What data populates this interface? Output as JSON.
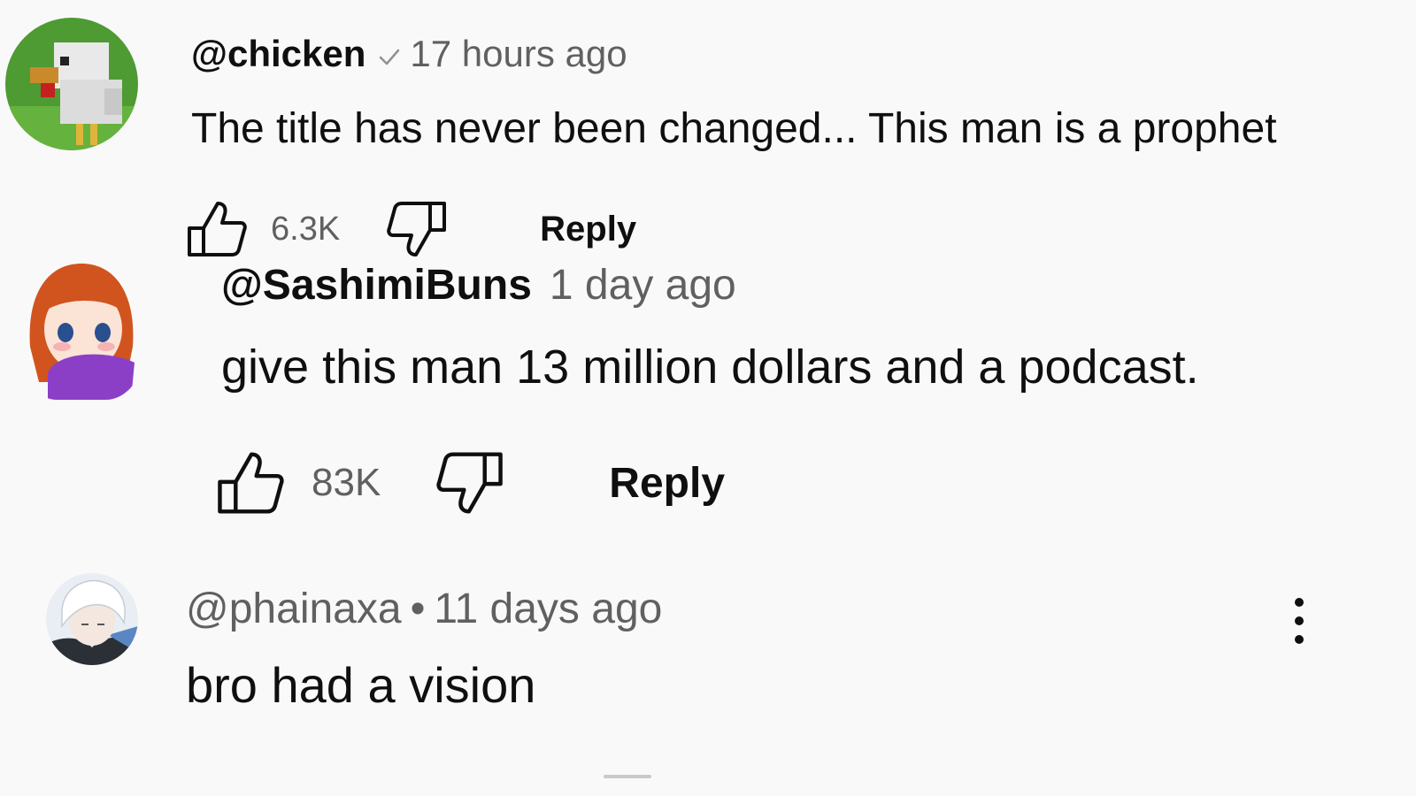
{
  "comments": [
    {
      "handle": "@chicken",
      "time": "17 hours ago",
      "text": "The title has never been changed... This man is a prophet",
      "likes": "6.3K",
      "reply_label": "Reply",
      "avatar_icon": "chicken-avatar-icon",
      "verified_icon": "check-icon"
    },
    {
      "handle": "@SashimiBuns",
      "time": "1 day ago",
      "text": "give this man 13 million dollars and a podcast.",
      "likes": "83K",
      "reply_label": "Reply",
      "avatar_icon": "anime-girl-avatar-icon"
    },
    {
      "handle": "@phainaxa",
      "separator": "•",
      "time": "11 days ago",
      "text": "bro had a vision",
      "avatar_icon": "white-hair-avatar-icon",
      "menu_icon": "more-vert-icon"
    }
  ],
  "colors": {
    "background": "#f9f9f9",
    "primary_text": "#0f0f0f",
    "secondary_text": "#606060"
  }
}
